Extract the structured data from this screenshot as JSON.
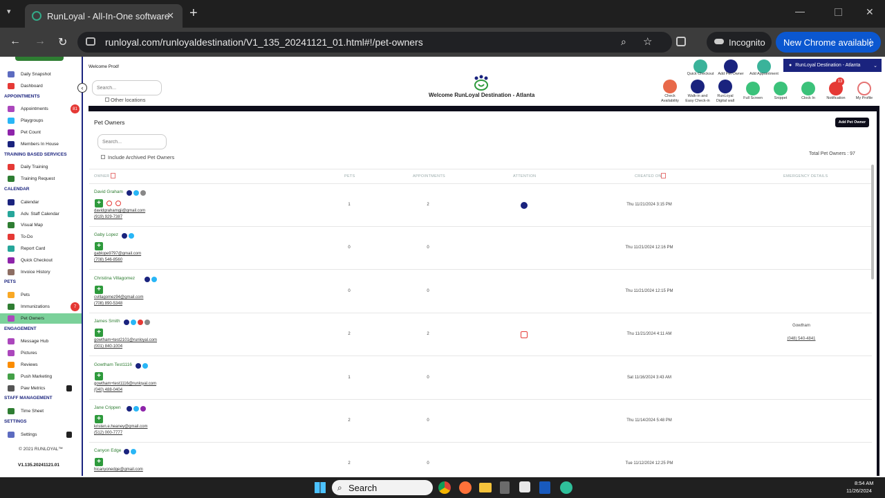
{
  "browser": {
    "tab_title": "RunLoyal - All-In-One software",
    "url": "runloyal.com/runloyaldestination/V1_135_20241121_01.html#!/pet-owners",
    "incognito": "Incognito",
    "new_chrome": "New Chrome available"
  },
  "sidebar": {
    "top_items": [
      "Daily Snapshot",
      "Dashboard"
    ],
    "sections": [
      {
        "title": "APPOINTMENTS",
        "items": [
          {
            "label": "Appointments",
            "badge": "81"
          },
          {
            "label": "Playgroups"
          },
          {
            "label": "Pet Count"
          },
          {
            "label": "Members In House"
          }
        ]
      },
      {
        "title": "TRAINING BASED SERVICES",
        "items": [
          {
            "label": "Daily Training"
          },
          {
            "label": "Training Request"
          }
        ]
      },
      {
        "title": "CALENDAR",
        "items": [
          {
            "label": "Calendar"
          },
          {
            "label": "Adv. Staff Calendar"
          },
          {
            "label": "Visual Map"
          },
          {
            "label": "To-Do"
          },
          {
            "label": "Report Card"
          },
          {
            "label": "Quick Checkout"
          },
          {
            "label": "Invoice History"
          }
        ]
      },
      {
        "title": "PETS",
        "items": [
          {
            "label": "Pets"
          },
          {
            "label": "Immunizations",
            "badge": "7"
          },
          {
            "label": "Pet Owners",
            "active": true
          }
        ]
      },
      {
        "title": "ENGAGEMENT",
        "items": [
          {
            "label": "Message Hub"
          },
          {
            "label": "Pictures"
          },
          {
            "label": "Reviews"
          },
          {
            "label": "Push Marketing"
          },
          {
            "label": "Paw Metrics",
            "lock": true
          }
        ]
      },
      {
        "title": "STAFF MANAGEMENT",
        "items": [
          {
            "label": "Time Sheet"
          }
        ]
      },
      {
        "title": "SETTINGS",
        "items": [
          {
            "label": "Settings",
            "lock": true
          }
        ]
      }
    ],
    "copyright": "© 2021 RUNLOYAL™",
    "version": "V1.135.20241121.01"
  },
  "header": {
    "welcome_user": "Welcome Prod!",
    "search_placeholder": "Search...",
    "other_locations": "Other locations",
    "center_title": "Welcome RunLoyal Destination - Atlanta",
    "location": "RunLoyal Destination - Atlanta",
    "top_actions": [
      "Quick Checkout",
      "Add Pet Owner",
      "Add Appointment"
    ],
    "actions": [
      "Check Availability",
      "Walk-in and Easy Check-in",
      "RunLoyal Digital wall",
      "Full Screen",
      "Snippet",
      "Clock In",
      "Notification",
      "My Profile"
    ],
    "notification_count": "13"
  },
  "panel": {
    "title": "Pet Owners",
    "add_button": "Add Pet Owner",
    "search_placeholder": "Search...",
    "include_archived": "Include Archived Pet Owners",
    "total": "Total Pet Owners : 97",
    "columns": [
      "OWNER",
      "PETS",
      "APPOINTMENTS",
      "ATTENTION",
      "CREATED ON",
      "EMERGENCY DETAILS"
    ],
    "rows": [
      {
        "name": "David Graham",
        "email": "davidgrahamgji@gmail.com",
        "phone": "(919) 929-7387",
        "pets": "1",
        "appointments": "2",
        "created": "Thu 11/21/2024 3:15 PM",
        "emergency_name": "",
        "emergency_phone": ""
      },
      {
        "name": "Gaby Lopez",
        "email": "gablope9797@gmail.com",
        "phone": "(708) 546-8560",
        "pets": "0",
        "appointments": "0",
        "created": "Thu 11/21/2024 12:16 PM",
        "emergency_name": "",
        "emergency_phone": ""
      },
      {
        "name": "Christina Villagomez",
        "email": "cvillagomez94@gmail.com",
        "phone": "(708) 890-5348",
        "pets": "0",
        "appointments": "0",
        "created": "Thu 11/21/2024 12:15 PM",
        "emergency_name": "",
        "emergency_phone": ""
      },
      {
        "name": "James Smith",
        "email": "gowtham+test2101@runloyal.com",
        "phone": "(001) 840-1004",
        "pets": "2",
        "appointments": "2",
        "created": "Thu 11/21/2024 4:11 AM",
        "emergency_name": "Gowtham",
        "emergency_phone": "(048) 540-4841"
      },
      {
        "name": "Gowtham Test1116",
        "email": "gowtham+test1116@runloyal.com",
        "phone": "(040) 488-0404",
        "pets": "1",
        "appointments": "0",
        "created": "Sat 11/16/2024 3:43 AM",
        "emergency_name": "",
        "emergency_phone": ""
      },
      {
        "name": "Jane Crippen",
        "email": "kristen.e.heaney@gmail.com",
        "phone": "(512) 000-7777",
        "pets": "2",
        "appointments": "0",
        "created": "Thu 11/14/2024 5:48 PM",
        "emergency_name": "",
        "emergency_phone": ""
      },
      {
        "name": "Canyon Edge",
        "email": "hicanyonedge@gmail.com",
        "phone": "",
        "pets": "2",
        "appointments": "0",
        "created": "Tue 11/12/2024 12:25 PM",
        "emergency_name": "",
        "emergency_phone": ""
      }
    ]
  },
  "taskbar": {
    "search": "Search",
    "time": "8:54 AM",
    "date": "11/26/2024"
  },
  "colors": {
    "navy": "#1a237e",
    "green": "#2e9a3c",
    "active": "#7bd19a",
    "badge": "#e53935"
  }
}
